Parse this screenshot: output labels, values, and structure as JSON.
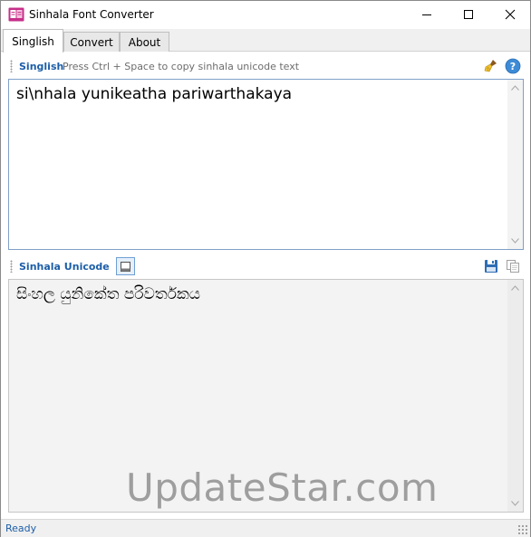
{
  "window": {
    "title": "Sinhala Font Converter"
  },
  "tabs": [
    {
      "label": "Singlish",
      "active": true
    },
    {
      "label": "Convert",
      "active": false
    },
    {
      "label": "About",
      "active": false
    }
  ],
  "input_panel": {
    "label": "Singlish",
    "hint": "Press Ctrl + Space to copy sinhala unicode text",
    "value": "si\\nhala yunikeatha pariwarthakaya"
  },
  "output_panel": {
    "label": "Sinhala Unicode",
    "value": "සිංහල යුනිකේත පරිවර්තකය"
  },
  "status": {
    "text": "Ready"
  },
  "watermark": "UpdateStar.com",
  "colors": {
    "accent": "#1c5ea8",
    "help": "#3d8bd6",
    "app_icon": "#c62f8a"
  },
  "icons": {
    "app": "sfc-app-icon",
    "clear": "broom-icon",
    "help": "help-icon",
    "preview": "window-icon",
    "save": "save-icon",
    "copy": "copy-icon"
  }
}
